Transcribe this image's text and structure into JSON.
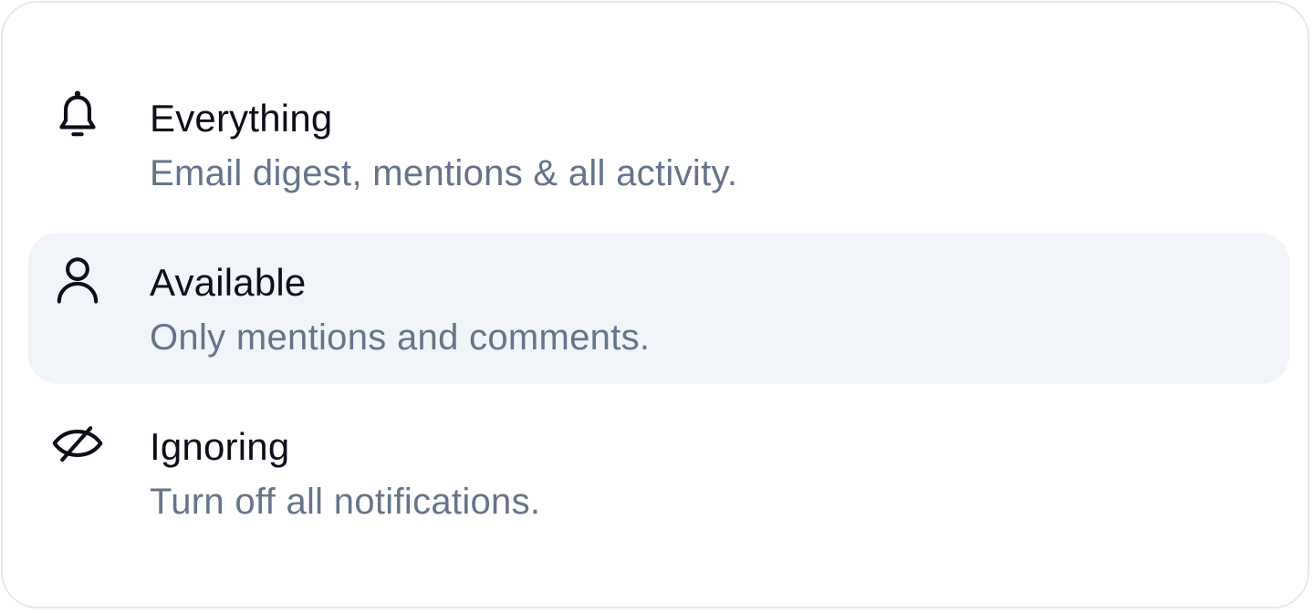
{
  "options": [
    {
      "icon": "bell-icon",
      "title": "Everything",
      "description": "Email digest, mentions & all activity.",
      "selected": false
    },
    {
      "icon": "user-icon",
      "title": "Available",
      "description": "Only mentions and comments.",
      "selected": true
    },
    {
      "icon": "eye-off-icon",
      "title": "Ignoring",
      "description": "Turn off all notifications.",
      "selected": false
    }
  ],
  "colors": {
    "title": "#0b0f1a",
    "description": "#64748b",
    "selected_background": "#f1f5f9",
    "border": "#e6e9f0"
  }
}
